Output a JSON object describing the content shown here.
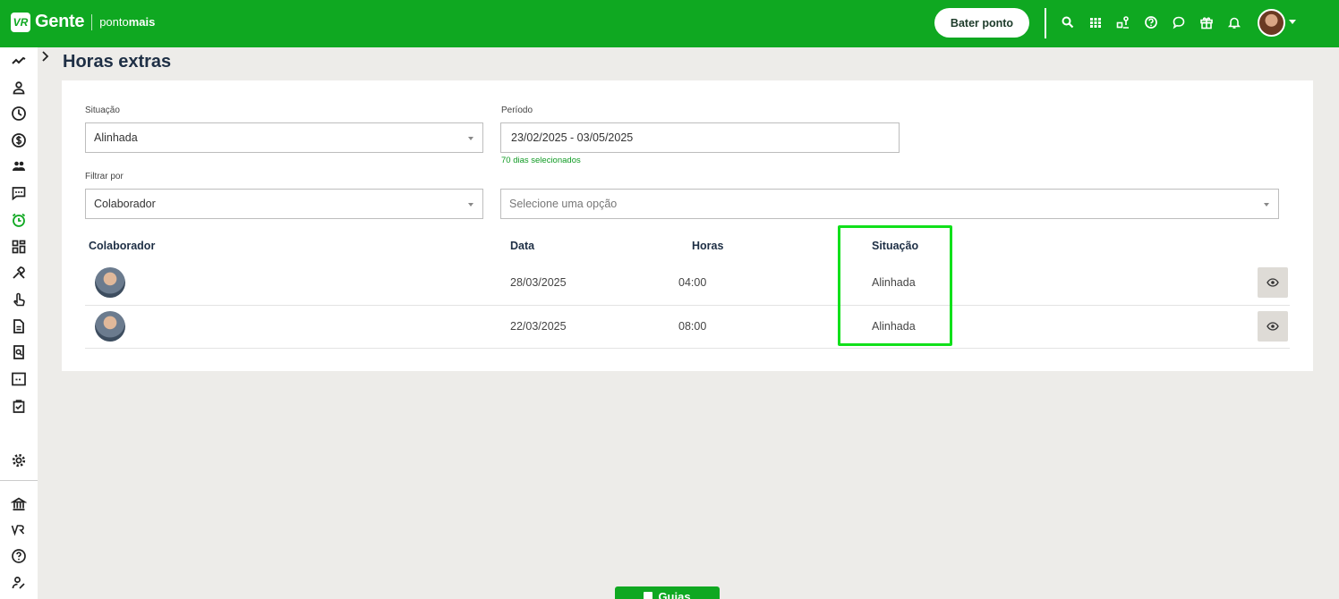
{
  "topbar": {
    "brand_logo": "VR",
    "brand_name": "Gente",
    "product_prefix": "ponto",
    "product_suffix": "mais",
    "punch_button": "Bater ponto",
    "icons": [
      "search-icon",
      "apps-grid-icon",
      "org-chart-icon",
      "help-icon",
      "chat-icon",
      "gift-icon",
      "bell-icon"
    ]
  },
  "sidebar": {
    "icons": [
      "trend-icon",
      "user-icon",
      "clock-icon",
      "dollar-icon",
      "team-icon",
      "message-icon",
      "alarm-icon",
      "dashboard-icon",
      "tools-icon",
      "touch-icon",
      "document-icon",
      "search-document-icon",
      "calendar-range-icon",
      "clipboard-icon",
      "settings-icon",
      "bank-icon",
      "vr-logo-icon",
      "help-icon",
      "user-edit-icon"
    ],
    "active": "alarm-icon"
  },
  "page": {
    "title": "Horas extras"
  },
  "filters": {
    "situacao_label": "Situação",
    "situacao_value": "Alinhada",
    "periodo_label": "Período",
    "periodo_value": "23/02/2025 - 03/05/2025",
    "periodo_hint": "70 dias selecionados",
    "filtrar_label": "Filtrar por",
    "filtrar_value": "Colaborador",
    "option_placeholder": "Selecione uma opção"
  },
  "table": {
    "headers": {
      "colaborador": "Colaborador",
      "data": "Data",
      "horas": "Horas",
      "situacao": "Situação"
    },
    "rows": [
      {
        "data": "28/03/2025",
        "horas": "04:00",
        "situacao": "Alinhada"
      },
      {
        "data": "22/03/2025",
        "horas": "08:00",
        "situacao": "Alinhada"
      }
    ]
  },
  "footer": {
    "guias_button": "Guias"
  },
  "colors": {
    "brand_green": "#0fa821",
    "highlight": "#11e01b",
    "background": "#edece9"
  }
}
